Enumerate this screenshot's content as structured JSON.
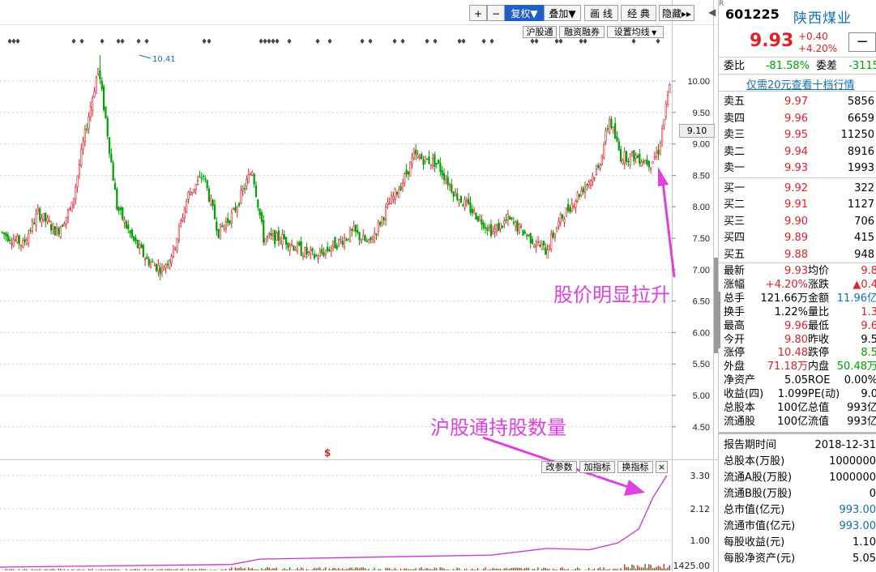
{
  "toolbar": {
    "plus": "+",
    "minus": "−",
    "fuquan": "复权▼",
    "diejia": "叠加▼",
    "huaxian": "画 线",
    "jingdian": "经 典",
    "yincang": "隐藏▸▸",
    "arrow": "◀"
  },
  "overlay_buttons": {
    "hugutong": "沪股通",
    "rongzi": "融资融券",
    "shezhi": "设置均线"
  },
  "indicator_buttons": {
    "gaicanshu": "改参数",
    "jiazhibiao": "加指标",
    "huanzhibiao": "换指标",
    "close": "×"
  },
  "annotations": {
    "price_rise": "股价明显拉升",
    "hk_holding": "沪股通持股数量",
    "dollar": "$",
    "crosshair": "9.10",
    "peak": "10.41"
  },
  "stock": {
    "code": "601225",
    "name": "陕西煤业",
    "superscript": "R",
    "price": "9.93",
    "change": "+0.40",
    "change_pct": "+4.20%",
    "weibi_label": "委比",
    "weibi": "-81.58%",
    "weicha_label": "委差",
    "weicha": "-3115",
    "promo": "仅需20元查看十档行情"
  },
  "sells": [
    {
      "label": "卖五",
      "price": "9.97",
      "vol": "5856"
    },
    {
      "label": "卖四",
      "price": "9.96",
      "vol": "6659"
    },
    {
      "label": "卖三",
      "price": "9.95",
      "vol": "11250"
    },
    {
      "label": "卖二",
      "price": "9.94",
      "vol": "8916"
    },
    {
      "label": "卖一",
      "price": "9.93",
      "vol": "1993"
    }
  ],
  "buys": [
    {
      "label": "买一",
      "price": "9.92",
      "vol": "322"
    },
    {
      "label": "买二",
      "price": "9.91",
      "vol": "1127"
    },
    {
      "label": "买三",
      "price": "9.90",
      "vol": "706"
    },
    {
      "label": "买四",
      "price": "9.89",
      "vol": "415"
    },
    {
      "label": "买五",
      "price": "9.88",
      "vol": "948"
    }
  ],
  "stats": [
    {
      "l1": "最新",
      "v1": "9.93",
      "c1": "red",
      "l2": "均价",
      "v2": "9.8",
      "c2": "red"
    },
    {
      "l1": "涨幅",
      "v1": "+4.20%",
      "c1": "red",
      "l2": "涨跌",
      "v2": "▲0.4",
      "c2": "red"
    },
    {
      "l1": "总手",
      "v1": "121.66万",
      "c1": "dark",
      "l2": "金额",
      "v2": "11.96亿",
      "c2": "blue"
    },
    {
      "l1": "换手",
      "v1": "1.22%",
      "c1": "dark",
      "l2": "量比",
      "v2": "1.3",
      "c2": "red"
    },
    {
      "l1": "最高",
      "v1": "9.96",
      "c1": "red",
      "l2": "最低",
      "v2": "9.6",
      "c2": "red"
    },
    {
      "l1": "今开",
      "v1": "9.80",
      "c1": "red",
      "l2": "昨收",
      "v2": "9.5",
      "c2": "dark"
    },
    {
      "l1": "涨停",
      "v1": "10.48",
      "c1": "red",
      "l2": "跌停",
      "v2": "8.5",
      "c2": "green"
    },
    {
      "l1": "外盘",
      "v1": "71.18万",
      "c1": "red",
      "l2": "内盘",
      "v2": "50.48万",
      "c2": "green"
    },
    {
      "l1": "净资产",
      "v1": "5.05",
      "c1": "dark",
      "l2": "ROE",
      "v2": "0.00%",
      "c2": "dark"
    },
    {
      "l1": "收益(四)",
      "v1": "1.099",
      "c1": "dark",
      "l2": "PE(动)",
      "v2": "9.0",
      "c2": "dark"
    },
    {
      "l1": "总股本",
      "v1": "100亿",
      "c1": "dark",
      "l2": "总值",
      "v2": "993亿",
      "c2": "dark"
    },
    {
      "l1": "流通股",
      "v1": "100亿",
      "c1": "dark",
      "l2": "流值",
      "v2": "993亿",
      "c2": "dark"
    }
  ],
  "finance": [
    {
      "label": "报告期时间",
      "value": "2018-12-31",
      "color": "dark"
    },
    {
      "label": "总股本(万股)",
      "value": "1000000",
      "color": "dark"
    },
    {
      "label": "流通A股(万股)",
      "value": "1000000",
      "color": "dark"
    },
    {
      "label": "流通B股(万股)",
      "value": "0",
      "color": "dark"
    },
    {
      "label": "总市值(亿元)",
      "value": "993.00",
      "color": "blue"
    },
    {
      "label": "流通市值(亿元)",
      "value": "993.00",
      "color": "blue"
    },
    {
      "label": "每股收益(元)",
      "value": "1.10",
      "color": "dark"
    },
    {
      "label": "每股净资产(元)",
      "value": "5.05",
      "color": "dark"
    }
  ],
  "colors": {
    "up": "#e0202a",
    "down": "#00a000",
    "holding": "#cc33cc",
    "arrow": "#e040e0",
    "accent": "#1f5fc8"
  },
  "chart_data": [
    {
      "type": "candlestick",
      "y_ticks": [
        "10.00",
        "9.50",
        "9.00",
        "8.50",
        "8.00",
        "7.50",
        "7.00",
        "6.50",
        "6.00",
        "5.50",
        "5.00",
        "4.50"
      ],
      "ylim": [
        4.2,
        10.6
      ],
      "waypoints": [
        [
          0,
          7.6
        ],
        [
          12,
          7.4
        ],
        [
          20,
          7.9
        ],
        [
          30,
          7.6
        ],
        [
          38,
          8.0
        ],
        [
          44,
          9.0
        ],
        [
          52,
          10.2
        ],
        [
          56,
          9.4
        ],
        [
          62,
          8.0
        ],
        [
          70,
          7.5
        ],
        [
          78,
          7.15
        ],
        [
          86,
          7.0
        ],
        [
          92,
          7.3
        ],
        [
          100,
          8.2
        ],
        [
          108,
          8.5
        ],
        [
          116,
          7.6
        ],
        [
          124,
          7.9
        ],
        [
          134,
          8.6
        ],
        [
          140,
          7.5
        ],
        [
          150,
          7.5
        ],
        [
          160,
          7.3
        ],
        [
          168,
          7.2
        ],
        [
          178,
          7.4
        ],
        [
          188,
          7.6
        ],
        [
          196,
          7.4
        ],
        [
          206,
          8.0
        ],
        [
          214,
          8.4
        ],
        [
          220,
          8.8
        ],
        [
          232,
          8.7
        ],
        [
          242,
          8.2
        ],
        [
          252,
          7.9
        ],
        [
          262,
          7.6
        ],
        [
          270,
          7.8
        ],
        [
          282,
          7.5
        ],
        [
          290,
          7.3
        ],
        [
          298,
          7.8
        ],
        [
          310,
          8.3
        ],
        [
          318,
          8.6
        ],
        [
          324,
          9.4
        ],
        [
          330,
          8.8
        ],
        [
          338,
          8.8
        ],
        [
          346,
          8.7
        ],
        [
          350,
          8.9
        ],
        [
          356,
          9.9
        ]
      ],
      "peak_value": 10.41,
      "crosshair": 9.1
    },
    {
      "type": "line",
      "name": "沪股通持股数量",
      "y_ticks": [
        "3.30",
        "2.12",
        "1.00"
      ],
      "volume_label": "1425.00",
      "points": [
        [
          0,
          0.0
        ],
        [
          0.33,
          0.1
        ],
        [
          0.37,
          0.3
        ],
        [
          0.7,
          0.45
        ],
        [
          0.78,
          0.7
        ],
        [
          0.84,
          0.65
        ],
        [
          0.88,
          0.9
        ],
        [
          0.91,
          1.4
        ],
        [
          0.93,
          2.5
        ],
        [
          0.95,
          3.3
        ]
      ]
    }
  ]
}
